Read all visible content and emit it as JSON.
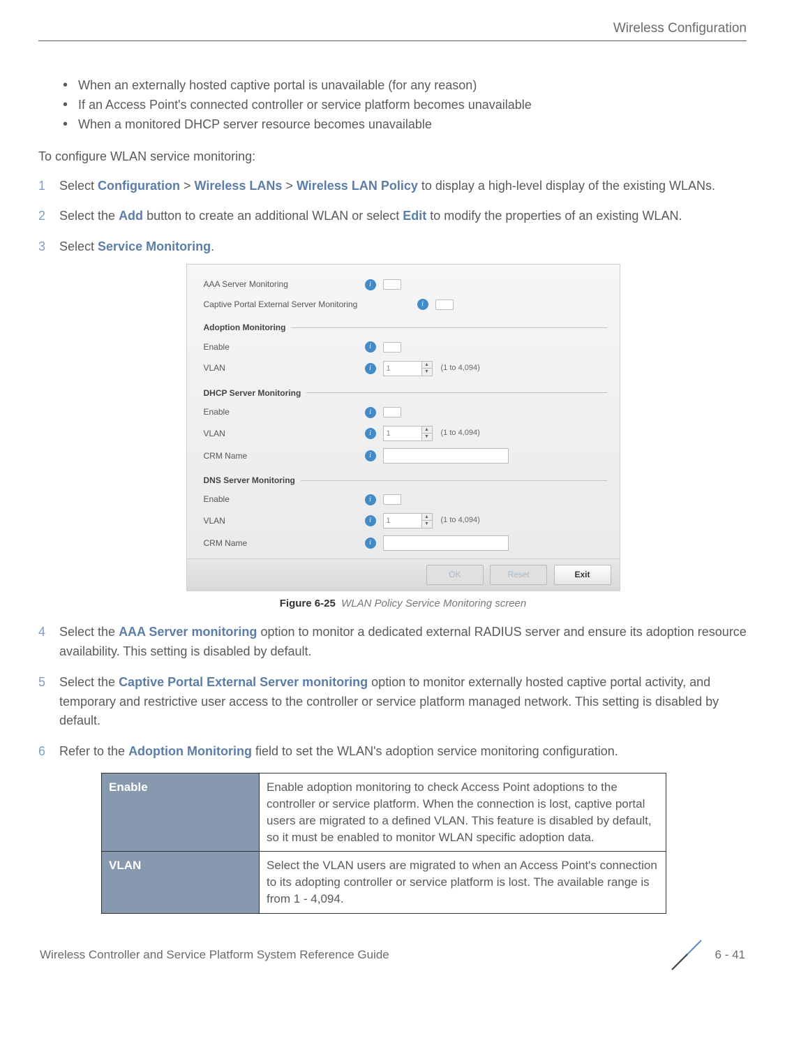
{
  "header": {
    "title": "Wireless Configuration"
  },
  "bullets": [
    "When an externally hosted captive portal is unavailable (for any reason)",
    "If an Access Point's connected controller or service platform becomes unavailable",
    "When a monitored DHCP server resource becomes unavailable"
  ],
  "intro": "To configure WLAN service monitoring:",
  "steps": {
    "s1_a": "Select ",
    "s1_link1": "Configuration",
    "s1_sep": " > ",
    "s1_link2": "Wireless LANs",
    "s1_link3": "Wireless LAN Policy",
    "s1_b": " to display a high-level display of the existing WLANs.",
    "s2_a": "Select the ",
    "s2_link1": "Add",
    "s2_b": " button to create an additional WLAN or select ",
    "s2_link2": "Edit",
    "s2_c": " to modify the properties of an existing WLAN.",
    "s3_a": "Select ",
    "s3_link1": "Service Monitoring",
    "s3_b": ".",
    "s4_a": "Select the ",
    "s4_link1": "AAA Server monitoring",
    "s4_b": " option to monitor a dedicated external RADIUS server and ensure its adoption resource availability. This setting is disabled by default.",
    "s5_a": "Select the ",
    "s5_link1": "Captive Portal External Server monitoring",
    "s5_b": " option to monitor externally hosted captive portal activity, and temporary and restrictive user access to the controller or service platform managed network. This setting is disabled by default.",
    "s6_a": "Refer to the ",
    "s6_link1": "Adoption Monitoring",
    "s6_b": " field to set the WLAN's adoption service monitoring configuration."
  },
  "shot": {
    "aaa_label": "AAA Server Monitoring",
    "captive_label": "Captive Portal External Server Monitoring",
    "group_adoption": "Adoption Monitoring",
    "group_dhcp": "DHCP Server Monitoring",
    "group_dns": "DNS Server Monitoring",
    "enable": "Enable",
    "vlan": "VLAN",
    "crm": "CRM Name",
    "vlan_hint": "(1 to 4,094)",
    "vlan_value": "1",
    "btn_ok": "OK",
    "btn_reset": "Reset",
    "btn_exit": "Exit"
  },
  "caption": {
    "fig": "Figure 6-25",
    "txt": "WLAN Policy Service Monitoring screen"
  },
  "table": {
    "r1k": "Enable",
    "r1v": "Enable adoption monitoring to check Access Point adoptions to the controller or service platform. When the connection is lost, captive portal users are migrated to a defined VLAN. This feature is disabled by default, so it must be enabled to monitor WLAN specific adoption data.",
    "r2k": "VLAN",
    "r2v": "Select the VLAN users are migrated to when an Access Point's connection to its adopting controller or service platform is lost. The available range is from 1 - 4,094."
  },
  "footer": {
    "left": "Wireless Controller and Service Platform System Reference Guide",
    "right": "6 - 41"
  }
}
